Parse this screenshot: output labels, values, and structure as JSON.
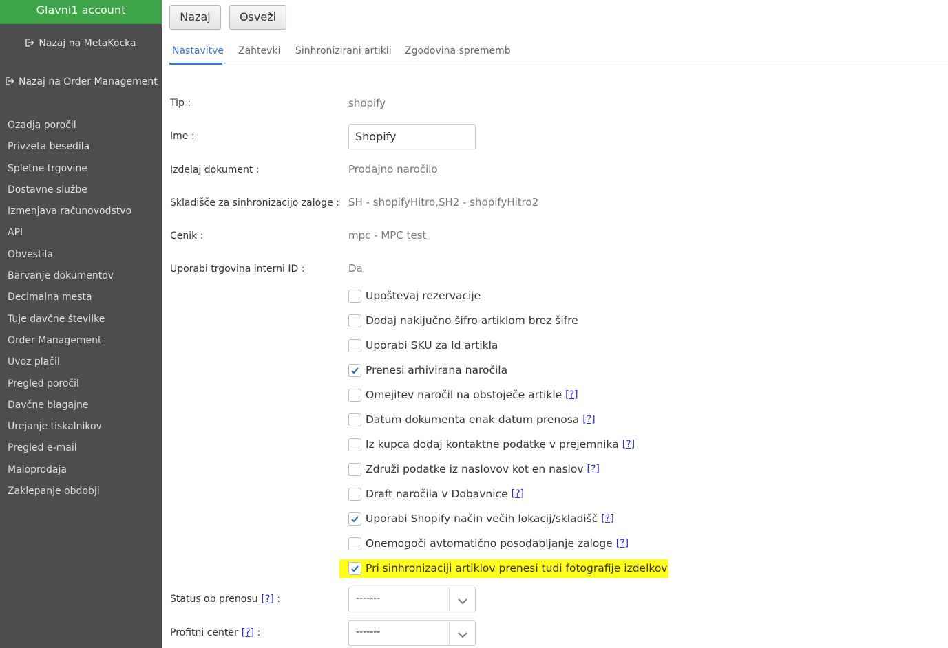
{
  "sidebar": {
    "account": "Glavni1 account",
    "back_meta": "Nazaj na MetaKocka",
    "back_order": "Nazaj na Order Management",
    "items": [
      "Ozadja poročil",
      "Privzeta besedila",
      "Spletne trgovine",
      "Dostavne službe",
      "Izmenjava računovodstvo",
      "API",
      "Obvestila",
      "Barvanje dokumentov",
      "Decimalna mesta",
      "Tuje davčne številke",
      "Order Management",
      "Uvoz plačil",
      "Pregled poročil",
      "Davčne blagajne",
      "Urejanje tiskalnikov",
      "Pregled e-mail",
      "Maloprodaja",
      "Zaklepanje obdobji"
    ]
  },
  "toolbar": {
    "back": "Nazaj",
    "refresh": "Osveži"
  },
  "tabs": [
    "Nastavitve",
    "Zahtevki",
    "Sinhronizirani artikli",
    "Zgodovina sprememb"
  ],
  "form": {
    "type_label": "Tip :",
    "type_value": "shopify",
    "name_label": "Ime :",
    "name_value": "Shopify",
    "doc_label": "Izdelaj dokument :",
    "doc_value": "Prodajno naročilo",
    "warehouse_label": "Skladišče za sinhronizacijo zaloge :",
    "warehouse_value": "SH - shopifyHitro,SH2 - shopifyHitro2",
    "pricelist_label": "Cenik :",
    "pricelist_value": "mpc - MPC test",
    "internal_id_label": "Uporabi trgovina interni ID :",
    "internal_id_value": "Da",
    "status_label": "Status ob prenosu",
    "status_value": "-------",
    "profit_label": "Profitni center",
    "profit_value": "-------",
    "help_text": "[?]",
    "colon": ":"
  },
  "checkboxes": [
    {
      "label": "Upoštevaj rezervacije",
      "checked": false,
      "help": false
    },
    {
      "label": "Dodaj naključno šifro artiklom brez šifre",
      "checked": false,
      "help": false
    },
    {
      "label": "Uporabi SKU za Id artikla",
      "checked": false,
      "help": false
    },
    {
      "label": "Prenesi arhivirana naročila",
      "checked": true,
      "help": false
    },
    {
      "label": "Omejitev naročil na obstoječe artikle",
      "checked": false,
      "help": true
    },
    {
      "label": "Datum dokumenta enak datum prenosa",
      "checked": false,
      "help": true
    },
    {
      "label": "Iz kupca dodaj kontaktne podatke v prejemnika",
      "checked": false,
      "help": true
    },
    {
      "label": "Združi podatke iz naslovov kot en naslov",
      "checked": false,
      "help": true
    },
    {
      "label": "Draft naročila v Dobavnice",
      "checked": false,
      "help": true
    },
    {
      "label": "Uporabi Shopify način večih lokacij/skladišč",
      "checked": true,
      "help": true
    },
    {
      "label": "Onemogoči avtomatično posodabljanje zaloge",
      "checked": false,
      "help": true
    },
    {
      "label": "Pri sinhronizaciji artiklov prenesi tudi fotografije izdelkov",
      "checked": true,
      "help": false,
      "highlighted": true
    }
  ],
  "colors": {
    "sidebar_bg": "#4d4d4d",
    "account_bg": "#3ea54a",
    "accent": "#3a7bc8",
    "highlight": "#ffff1a",
    "help_link": "#2a2acf"
  }
}
